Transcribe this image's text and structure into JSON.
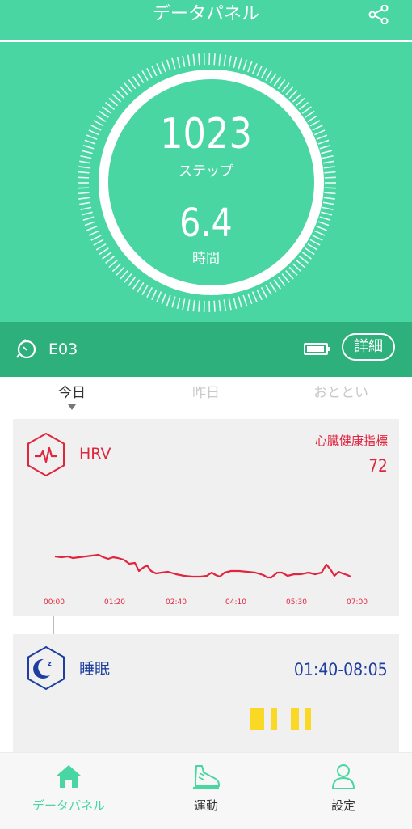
{
  "header": {
    "title": "データパネル"
  },
  "summary": {
    "steps_value": "1023",
    "steps_label": "ステップ",
    "hours_value": "6.4",
    "hours_label": "時間"
  },
  "device": {
    "name": "E03",
    "detail_label": "詳細"
  },
  "day_tabs": [
    "今日",
    "昨日",
    "おととい"
  ],
  "hrv": {
    "title": "HRV",
    "index_label": "心臓健康指標",
    "index_value": "72",
    "color": "#E0253F",
    "x_ticks": [
      "00:00",
      "01:20",
      "02:40",
      "04:10",
      "05:30",
      "07:00"
    ]
  },
  "sleep": {
    "title": "睡眠",
    "range": "01:40-08:05",
    "color": "#1F3FA0",
    "block_color": "#F9D926"
  },
  "nav": [
    {
      "label": "データパネル",
      "icon": "home-icon"
    },
    {
      "label": "運動",
      "icon": "running-shoe-icon"
    },
    {
      "label": "設定",
      "icon": "person-icon"
    }
  ],
  "colors": {
    "accent": "#49D6A2",
    "device_bar": "#2EB07C"
  }
}
